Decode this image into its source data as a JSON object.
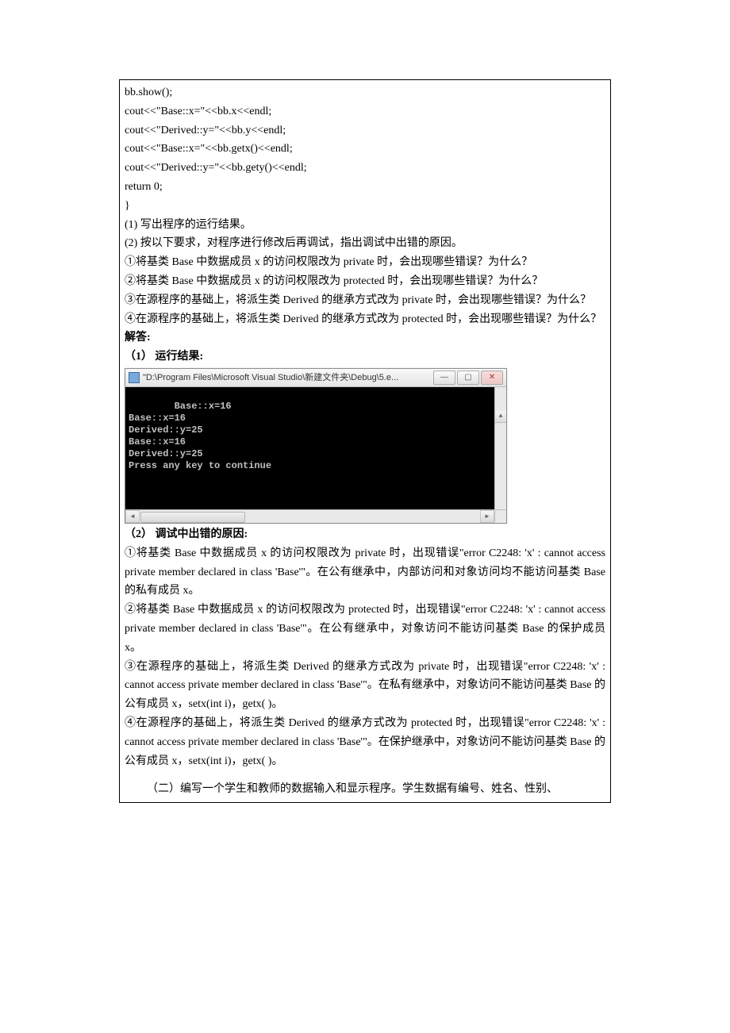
{
  "code": {
    "l1": "bb.show();",
    "l2": "cout<<\"Base::x=\"<<bb.x<<endl;",
    "l3": "cout<<\"Derived::y=\"<<bb.y<<endl;",
    "l4": "cout<<\"Base::x=\"<<bb.getx()<<endl;",
    "l5": "cout<<\"Derived::y=\"<<bb.gety()<<endl;",
    "l6": "return 0;",
    "l7": "}"
  },
  "questions": {
    "q1": "(1)  写出程序的运行结果。",
    "q2": "(2)  按以下要求，对程序进行修改后再调试，指出调试中出错的原因。",
    "q2a": "①将基类 Base 中数据成员 x 的访问权限改为 private 时，会出现哪些错误？为什么？",
    "q2b": "②将基类 Base 中数据成员 x 的访问权限改为 protected 时，会出现哪些错误？为什么？",
    "q2c": "③在源程序的基础上，将派生类 Derived 的继承方式改为 private 时，会出现哪些错误？为什么？",
    "q2d": "④在源程序的基础上，将派生类 Derived 的继承方式改为 protected 时，会出现哪些错误？为什么？"
  },
  "answer_header": " 解答:",
  "part1_label": "（1）  运行结果:",
  "console": {
    "title": "\"D:\\Program Files\\Microsoft Visual Studio\\新建文件夹\\Debug\\5.e...",
    "lines": "Base::x=16\nBase::x=16\nDerived::y=25\nBase::x=16\nDerived::y=25\nPress any key to continue"
  },
  "win_btn": {
    "min": "—",
    "max": "▢",
    "close": "✕"
  },
  "part2_label": "（2）  调试中出错的原因:",
  "answers": {
    "a1": "①将基类 Base 中数据成员 x 的访问权限改为 private 时，出现错误\"error C2248: 'x' : cannot access private member declared in class 'Base'\"。在公有继承中，内部访问和对象访问均不能访问基类 Base 的私有成员 x。",
    "a2": "②将基类 Base 中数据成员 x 的访问权限改为 protected 时，出现错误\"error C2248: 'x' : cannot access private member declared in class 'Base'\"。在公有继承中，对象访问不能访问基类 Base 的保护成员 x。",
    "a3": "③在源程序的基础上，将派生类 Derived 的继承方式改为 private 时，出现错误\"error C2248: 'x' : cannot access private member declared in class 'Base'\"。在私有继承中，对象访问不能访问基类 Base 的公有成员 x，setx(int i)，getx( )。",
    "a4": "④在源程序的基础上，将派生类 Derived 的继承方式改为 protected 时，出现错误\"error C2248: 'x' : cannot access private member declared in class 'Base'\"。在保护继承中，对象访问不能访问基类 Base 的公有成员 x，setx(int i)，getx( )。"
  },
  "next_section": "（二）编写一个学生和教师的数据输入和显示程序。学生数据有编号、姓名、性别、"
}
